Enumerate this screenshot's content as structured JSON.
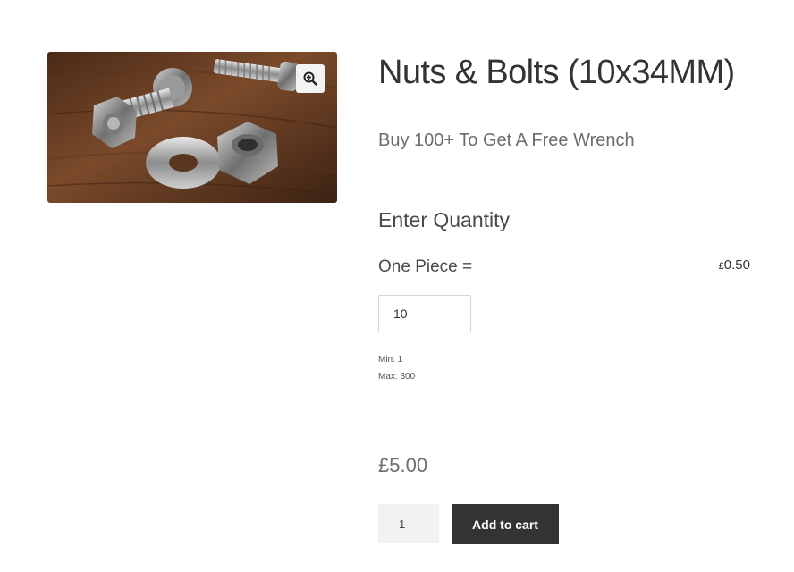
{
  "product": {
    "image_alt": "Nuts and bolts on a wooden surface",
    "title": "Nuts & Bolts (10x34MM)",
    "subtitle": "Buy 100+ To Get A Free Wrench"
  },
  "quantity_section": {
    "heading": "Enter Quantity",
    "option_label": "One Piece =",
    "option_price_currency": "£",
    "option_price_amount": "0.50",
    "quantity_value": "10",
    "min_label": "Min: 1",
    "max_label": "Max: 300"
  },
  "total_price": "£5.00",
  "cart": {
    "quantity": "1",
    "add_to_cart_label": "Add to cart"
  },
  "icons": {
    "zoom": "zoom-in-icon"
  },
  "colors": {
    "button_bg": "#333333",
    "button_text": "#ffffff"
  }
}
